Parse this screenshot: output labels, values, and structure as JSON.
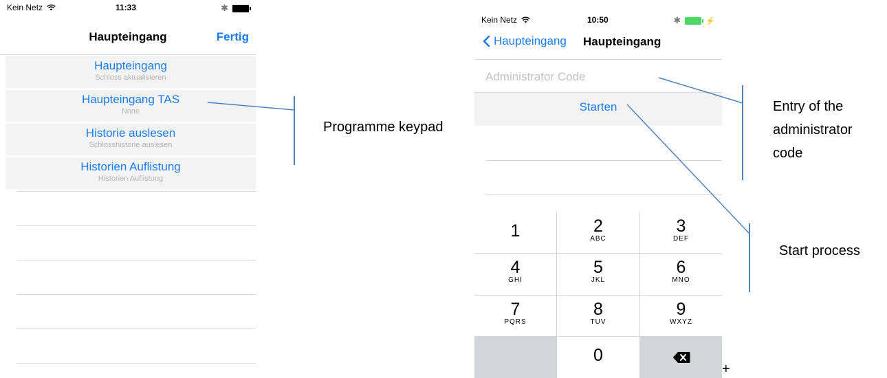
{
  "phone1": {
    "status": {
      "carrier": "Kein Netz",
      "time": "11:33"
    },
    "nav": {
      "title": "Haupteingang",
      "done": "Fertig"
    },
    "menu": [
      {
        "title": "Haupteingang",
        "subtitle": "Schloss aktualisieren"
      },
      {
        "title": "Haupteingang TAS",
        "subtitle": "None"
      },
      {
        "title": "Historie auslesen",
        "subtitle": "Schlosshistorie auslesen"
      },
      {
        "title": "Historien Auflistung",
        "subtitle": "Historien Auflistung"
      }
    ]
  },
  "phone2": {
    "status": {
      "carrier": "Kein Netz",
      "time": "10:50"
    },
    "nav": {
      "back": "Haupteingang",
      "title": "Haupteingang"
    },
    "code_placeholder": "Administrator Code",
    "start_button": "Starten",
    "keypad": [
      {
        "digit": "1",
        "letters": ""
      },
      {
        "digit": "2",
        "letters": "ABC"
      },
      {
        "digit": "3",
        "letters": "DEF"
      },
      {
        "digit": "4",
        "letters": "GHI"
      },
      {
        "digit": "5",
        "letters": "JKL"
      },
      {
        "digit": "6",
        "letters": "MNO"
      },
      {
        "digit": "7",
        "letters": "PQRS"
      },
      {
        "digit": "8",
        "letters": "TUV"
      },
      {
        "digit": "9",
        "letters": "WXYZ"
      },
      {
        "digit": "0",
        "letters": ""
      }
    ]
  },
  "annotations": {
    "keypad_label": "Programme keypad",
    "code_label": [
      "Entry of the",
      "administrator",
      "code"
    ],
    "start_label": "Start process",
    "plus": "+"
  },
  "colors": {
    "accent": "#1a7cf0",
    "annotation_line": "#4f81bd",
    "keypad_bg": "#d2d5da"
  }
}
